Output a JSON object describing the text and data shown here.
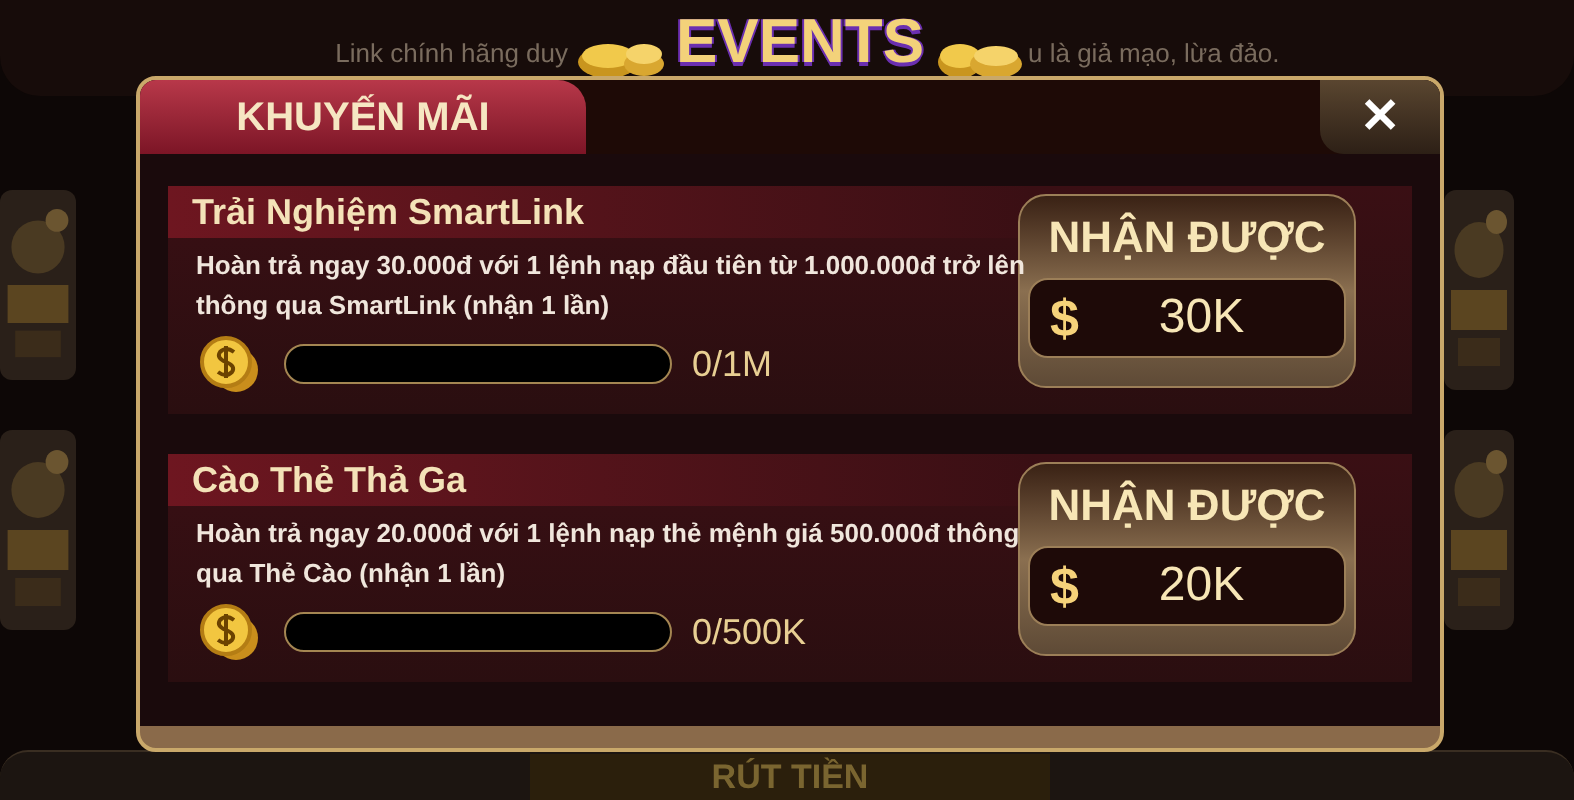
{
  "background": {
    "notice_left": "Link chính hãng duy",
    "notice_right": "u là giả mạo, lừa đảo.",
    "bottom_button": "RÚT TIỀN"
  },
  "banner": {
    "title": "EVENTS"
  },
  "dialog": {
    "tab": "KHUYẾN MÃI",
    "close": "✕"
  },
  "promotions": [
    {
      "title": "Trải Nghiệm SmartLink",
      "description": "Hoàn trả ngay 30.000đ với 1 lệnh nạp đầu tiên từ 1.000.000đ trở lên thông qua SmartLink (nhận 1 lần)",
      "level": 0,
      "progress": "0/1M",
      "reward_label": "NHẬN ĐƯỢC",
      "currency": "$",
      "reward": "30K"
    },
    {
      "title": "Cào Thẻ Thả Ga",
      "description": "Hoàn trả ngay 20.000đ với 1 lệnh nạp thẻ mệnh giá 500.000đ thông qua Thẻ Cào (nhận 1 lần)",
      "level": 0,
      "progress": "0/500K",
      "reward_label": "NHẬN ĐƯỢC",
      "currency": "$",
      "reward": "20K"
    }
  ]
}
